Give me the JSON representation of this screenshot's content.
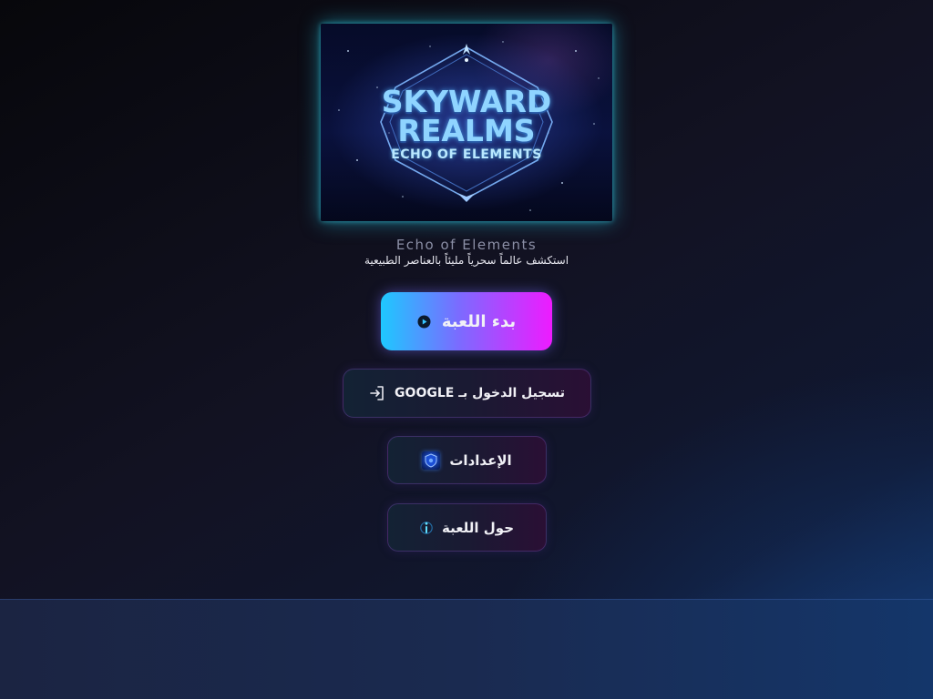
{
  "banner": {
    "line1": "SKYWARD",
    "line2": "REALMS",
    "sub": "ECHO OF ELEMENTS"
  },
  "header": {
    "subtitle": "Echo of Elements",
    "tagline": "استكشف عالماً سحرياً مليئاً بالعناصر الطبيعية"
  },
  "menu": {
    "start": {
      "label": "بدء اللعبة",
      "icon": "play-icon"
    },
    "google": {
      "label": "تسجيل الدخول بـ GOOGLE",
      "icon": "login-icon"
    },
    "settings": {
      "label": "الإعدادات",
      "icon": "shield-icon"
    },
    "about": {
      "label": "حول اللعبة",
      "icon": "info-icon"
    }
  },
  "colors": {
    "accent_cyan": "#1ec8ff",
    "accent_magenta": "#ee1bff",
    "background": "#0b0b12"
  }
}
